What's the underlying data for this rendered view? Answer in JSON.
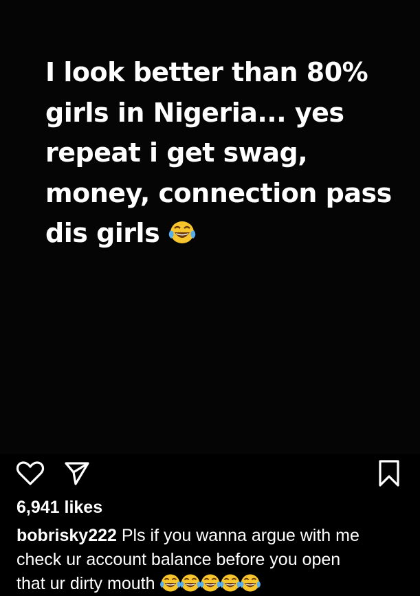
{
  "post": {
    "text_lines": [
      "I look better than 80%",
      "girls in Nigeria... yes",
      "repeat i get swag,",
      "money, connection pass",
      "dis girls"
    ],
    "text_emoji": "laughing-tears-emoji"
  },
  "actions": {
    "like_icon": "heart-icon",
    "share_icon": "paper-plane-icon",
    "save_icon": "bookmark-icon"
  },
  "likes": "6,941 likes",
  "caption": {
    "username": "bobrisky222",
    "line1_text": " Pls if you wanna argue with me",
    "line2_text": "check ur account balance before you open",
    "line3_text": "that ur dirty mouth",
    "emoji_count": 5,
    "emoji": "laughing-tears-emoji"
  },
  "colors": {
    "background": "#000000",
    "text": "#ffffff",
    "emoji_face": "#f7c52d",
    "emoji_tears": "#5aaee8"
  }
}
